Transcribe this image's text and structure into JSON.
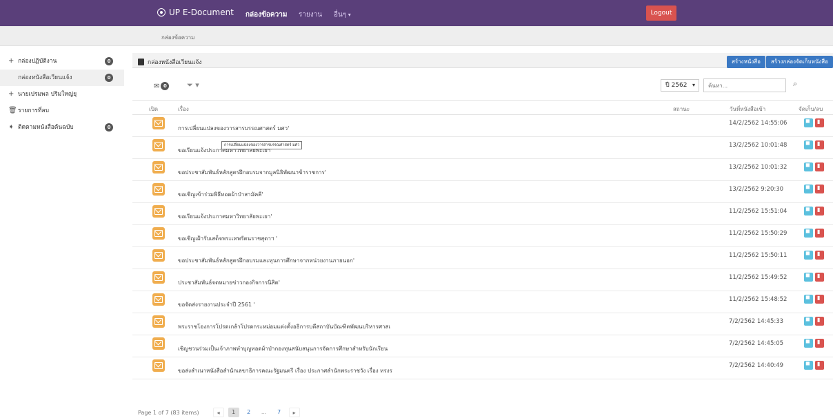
{
  "navbar": {
    "brand": "UP E-Document",
    "items": [
      "กล่องข้อความ",
      "รายงาน",
      "อื่นๆ"
    ],
    "logout": "Logout"
  },
  "breadcrumb": "กล่องข้อความ",
  "sidebar": {
    "items": [
      {
        "icon": "+",
        "label": "กล่องปฏิบัติงาน",
        "badge": "0"
      },
      {
        "icon": "",
        "label": "กล่องหนังสือเวียนแจ้ง",
        "badge": "0"
      },
      {
        "icon": "+",
        "label": "นายเปรมพล ปริมใหญ่ยุ",
        "badge": ""
      },
      {
        "icon": "trash",
        "label": "รายการที่ลบ",
        "badge": ""
      },
      {
        "icon": "tag",
        "label": "ติดตามหนังสือต้นฉบับ",
        "badge": "0"
      }
    ]
  },
  "panel": {
    "title": "กล่องหนังสือเวียนแจ้ง",
    "btn_create": "สร้างหนังสือ",
    "btn_create_box": "สร้างกล่องจัดเก็บหนังสือ"
  },
  "toolbar": {
    "mail_count": "0",
    "year": "ปี 2562",
    "search_placeholder": "ค้นหา..."
  },
  "table": {
    "headers": [
      "เปิด",
      "เรื่อง",
      "สถานะ",
      "วันที่หนังสือเข้า",
      "จัดเก็บ/ลบ"
    ],
    "rows": [
      {
        "subject": "การเปลี่ยนแปลงของวารสารบรรณศาสตร์ มศว'",
        "date": "14/2/2562 14:55:06"
      },
      {
        "subject": "ขอเรียนแจ้งประกาศมหาวิทยาลัยพะเยา'",
        "date": "13/2/2562 10:01:48"
      },
      {
        "subject": "ขอประชาสัมพันธ์หลักสูตรฝึกอบรมจากมูลนิธิพัฒนาข้าราชการ'",
        "date": "13/2/2562 10:01:32"
      },
      {
        "subject": "ขอเชิญเข้าร่วมพิธีทอดผ้าป่าสามัคคี'",
        "date": "13/2/2562 9:20:30"
      },
      {
        "subject": "ขอเรียนแจ้งประกาศมหาวิทยาลัยพะเยา'",
        "date": "11/2/2562 15:51:04"
      },
      {
        "subject": "ขอเชิญเฝ้ารับเสด็จพระเทพรัตนราชสุดาฯ '",
        "date": "11/2/2562 15:50:29"
      },
      {
        "subject": "ขอประชาสัมพันธ์หลักสูตรฝึกอบรมและทุนการศึกษาจากหน่วยงานภายนอก'",
        "date": "11/2/2562 15:50:11"
      },
      {
        "subject": "ประชาสัมพันธ์จดหมายข่าวกองกิจการนิสิต'",
        "date": "11/2/2562 15:49:52"
      },
      {
        "subject": "ขอจัดส่งรายงานประจำปี 2561 '",
        "date": "11/2/2562 15:48:52"
      },
      {
        "subject": "พระราชโองการโปรดเกล้าโปรดกระหม่อมแต่งตั้งอธิการบดีสถาบันบัณฑิตพัฒนบริหารศาสเ",
        "date": "7/2/2562 14:45:33"
      },
      {
        "subject": "เชิญชวนร่วมเป็นเจ้าภาพทำบุญทอดผ้าป่ากองทุนสนับสนุนการจัดการศึกษาสำหรับนักเรียน",
        "date": "7/2/2562 14:45:05"
      },
      {
        "subject": "ขอส่งสำเนาหนังสือสำนักเลขาธิการคณะรัฐมนตรี เรื่อง ประกาศสำนักพระราชวัง เรื่อง ทรงร",
        "date": "7/2/2562 14:40:49"
      }
    ],
    "tooltip": "การเปลี่ยนแปลงของวารสารบรรณศาสตร์ มศว"
  },
  "pager": {
    "info": "Page 1 of 7 (83 items)",
    "pages": [
      "1",
      "2",
      "...",
      "7"
    ]
  },
  "colors": {
    "navbar": "#5a3f7a",
    "logout": "#d9534f",
    "primary": "#3a78c3",
    "envelope": "#f0ad4e",
    "save": "#5bc0de",
    "delete": "#d9534f"
  }
}
